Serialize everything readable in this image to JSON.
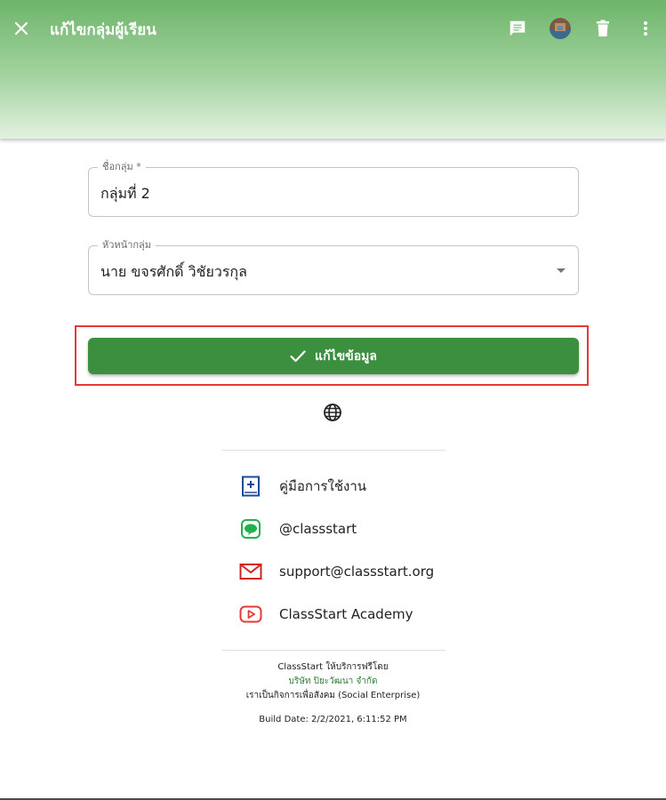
{
  "header": {
    "title": "แก้ไขกลุ่มผู้เรียน",
    "accent": "#6db56a"
  },
  "form": {
    "group_name": {
      "label": "ชื่อกลุ่ม *",
      "value": "กลุ่มที่ 2"
    },
    "leader": {
      "label": "หัวหน้ากลุ่ม",
      "value": "นาย ขจรศักดิ์ วิชัยวรกุล"
    },
    "submit_label": "แก้ไขข้อมูล",
    "submit_color": "#3b8f3f"
  },
  "links": [
    {
      "icon": "manual-book-icon",
      "label": "คู่มือการใช้งาน"
    },
    {
      "icon": "line-icon",
      "label": "@classstart"
    },
    {
      "icon": "mail-icon",
      "label": "support@classstart.org"
    },
    {
      "icon": "youtube-icon",
      "label": "ClassStart Academy"
    }
  ],
  "footer": {
    "service_line": "ClassStart ให้บริการฟรีโดย",
    "company": "บริษัท ปิยะวัฒนา จำกัด",
    "enterprise_line": "เราเป็นกิจการเพื่อสังคม (Social Enterprise)",
    "build_date": "Build Date: 2/2/2021, 6:11:52 PM"
  }
}
